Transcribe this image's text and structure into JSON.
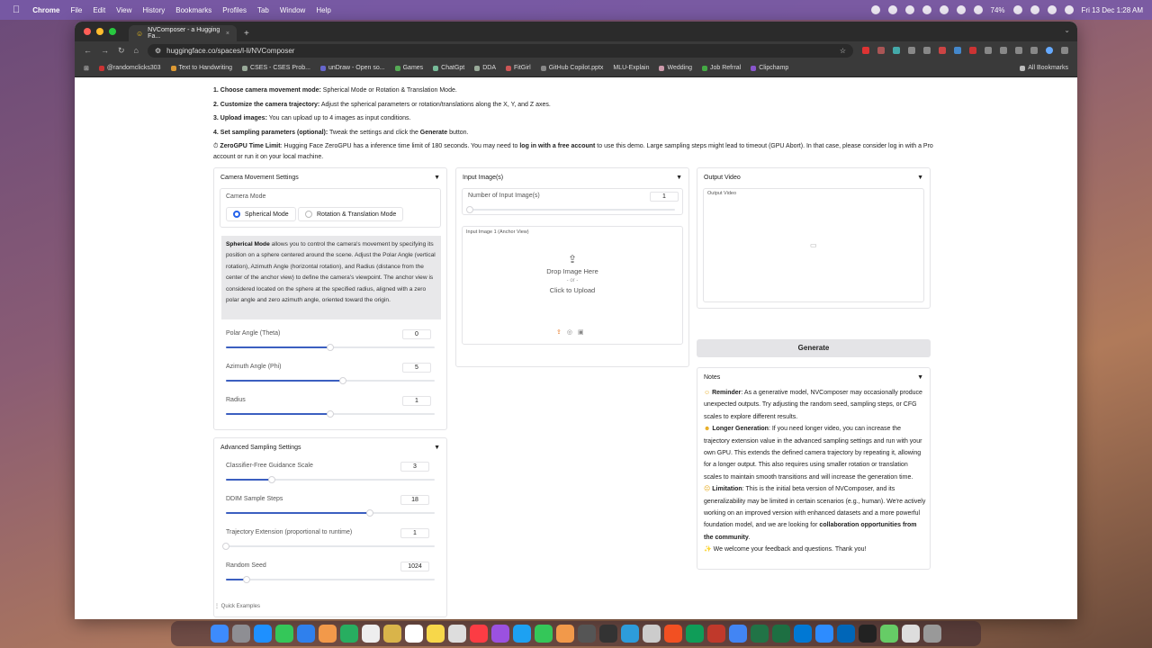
{
  "menubar": {
    "app": "Chrome",
    "items": [
      "File",
      "Edit",
      "View",
      "History",
      "Bookmarks",
      "Profiles",
      "Tab",
      "Window",
      "Help"
    ],
    "battery": "74%",
    "datetime": "Fri 13 Dec 1:28 AM"
  },
  "browser": {
    "tab_title": "NVComposer - a Hugging Fa...",
    "url": "huggingface.co/spaces/l-li/NVComposer",
    "bookmarks": [
      "@randomclicks303",
      "Text to Handwriting",
      "CSES - CSES Prob...",
      "unDraw - Open so...",
      "Games",
      "ChatGpt",
      "DDA",
      "FitGirl",
      "GitHub Copilot.pptx",
      "MLU-Explain",
      "Wedding",
      "Job Refrral",
      "Clipchamp"
    ],
    "all_bookmarks": "All Bookmarks"
  },
  "instructions": {
    "step1_bold": "1. Choose camera movement mode:",
    "step1_text": " Spherical Mode or Rotation & Translation Mode.",
    "step2_bold": "2. Customize the camera trajectory:",
    "step2_text": " Adjust the spherical parameters or rotation/translations along the X, Y, and Z axes.",
    "step3_bold": "3. Upload images:",
    "step3_text": " You can upload up to 4 images as input conditions.",
    "step4_bold": "4. Set sampling parameters (optional):",
    "step4_text": " Tweak the settings and click the ",
    "step4_bold2": "Generate",
    "step4_text2": " button.",
    "zerogpu_icon": "⏱",
    "zerogpu_bold": " ZeroGPU Time Limit",
    "zerogpu_text1": ": Hugging Face ZeroGPU has a inference time limit of 180 seconds. You may need to ",
    "zerogpu_bold2": "log in with a free account",
    "zerogpu_text2": " to use this demo. Large sampling steps might lead to timeout (GPU Abort). In that case, please consider log in with a Pro account or run it on your local machine."
  },
  "camera": {
    "title": "Camera Movement Settings",
    "mode_label": "Camera Mode",
    "mode_spherical": "Spherical Mode",
    "mode_rt": "Rotation & Translation Mode",
    "desc_bold": "Spherical Mode",
    "desc_text": " allows you to control the camera's movement by specifying its position on a sphere centered around the scene. Adjust the Polar Angle (vertical rotation), Azimuth Angle (horizontal rotation), and Radius (distance from the center of the anchor view) to define the camera's viewpoint. The anchor view is considered located on the sphere at the specified radius, aligned with a zero polar angle and zero azimuth angle, oriented toward the origin.",
    "polar_label": "Polar Angle (Theta)",
    "polar_value": "0",
    "polar_fill": 0.5,
    "azimuth_label": "Azimuth Angle (Phi)",
    "azimuth_value": "5",
    "azimuth_fill": 0.56,
    "radius_label": "Radius",
    "radius_value": "1",
    "radius_fill": 0.5
  },
  "advanced": {
    "title": "Advanced Sampling Settings",
    "cfg_label": "Classifier-Free Guidance Scale",
    "cfg_value": "3",
    "cfg_fill": 0.22,
    "ddim_label": "DDIM Sample Steps",
    "ddim_value": "18",
    "ddim_fill": 0.69,
    "traj_label": "Trajectory Extension (proportional to runtime)",
    "traj_value": "1",
    "traj_fill": 0.0,
    "seed_label": "Random Seed",
    "seed_value": "1024",
    "seed_fill": 0.1
  },
  "input": {
    "title": "Input Image(s)",
    "num_label": "Number of Input Image(s)",
    "num_value": "1",
    "num_fill": 0.0,
    "image1_label": "Input Image 1 (Anchor View)",
    "drop_text": "Drop Image Here",
    "or_text": "- or -",
    "click_text": "Click to Upload"
  },
  "output": {
    "title": "Output Video",
    "video_label": "Output Video",
    "generate": "Generate"
  },
  "notes": {
    "title": "Notes",
    "reminder_bold": "Reminder",
    "reminder_text": ": As a generative model, NVComposer may occasionally produce unexpected outputs. Try adjusting the random seed, sampling steps, or CFG scales to explore different results.",
    "longer_bold": "Longer Generation",
    "longer_text": ": If you need longer video, you can increase the trajectory extension value in the advanced sampling settings and run with your own GPU. This extends the defined camera trajectory by repeating it, allowing for a longer output. This also requires using smaller rotation or translation scales to maintain smooth transitions and will increase the generation time.",
    "limitation_bold": "Limitation",
    "limitation_text": ": This is the initial beta version of NVComposer, and its generalizability may be limited in certain scenarios (e.g., human). We're actively working on an improved version with enhanced datasets and a more powerful foundation model, and we are looking for ",
    "collab_bold": "collaboration opportunities from the community",
    "collab_end": ".",
    "welcome": " We welcome your feedback and questions. Thank you!"
  },
  "quick_examples": "Quick Examples"
}
